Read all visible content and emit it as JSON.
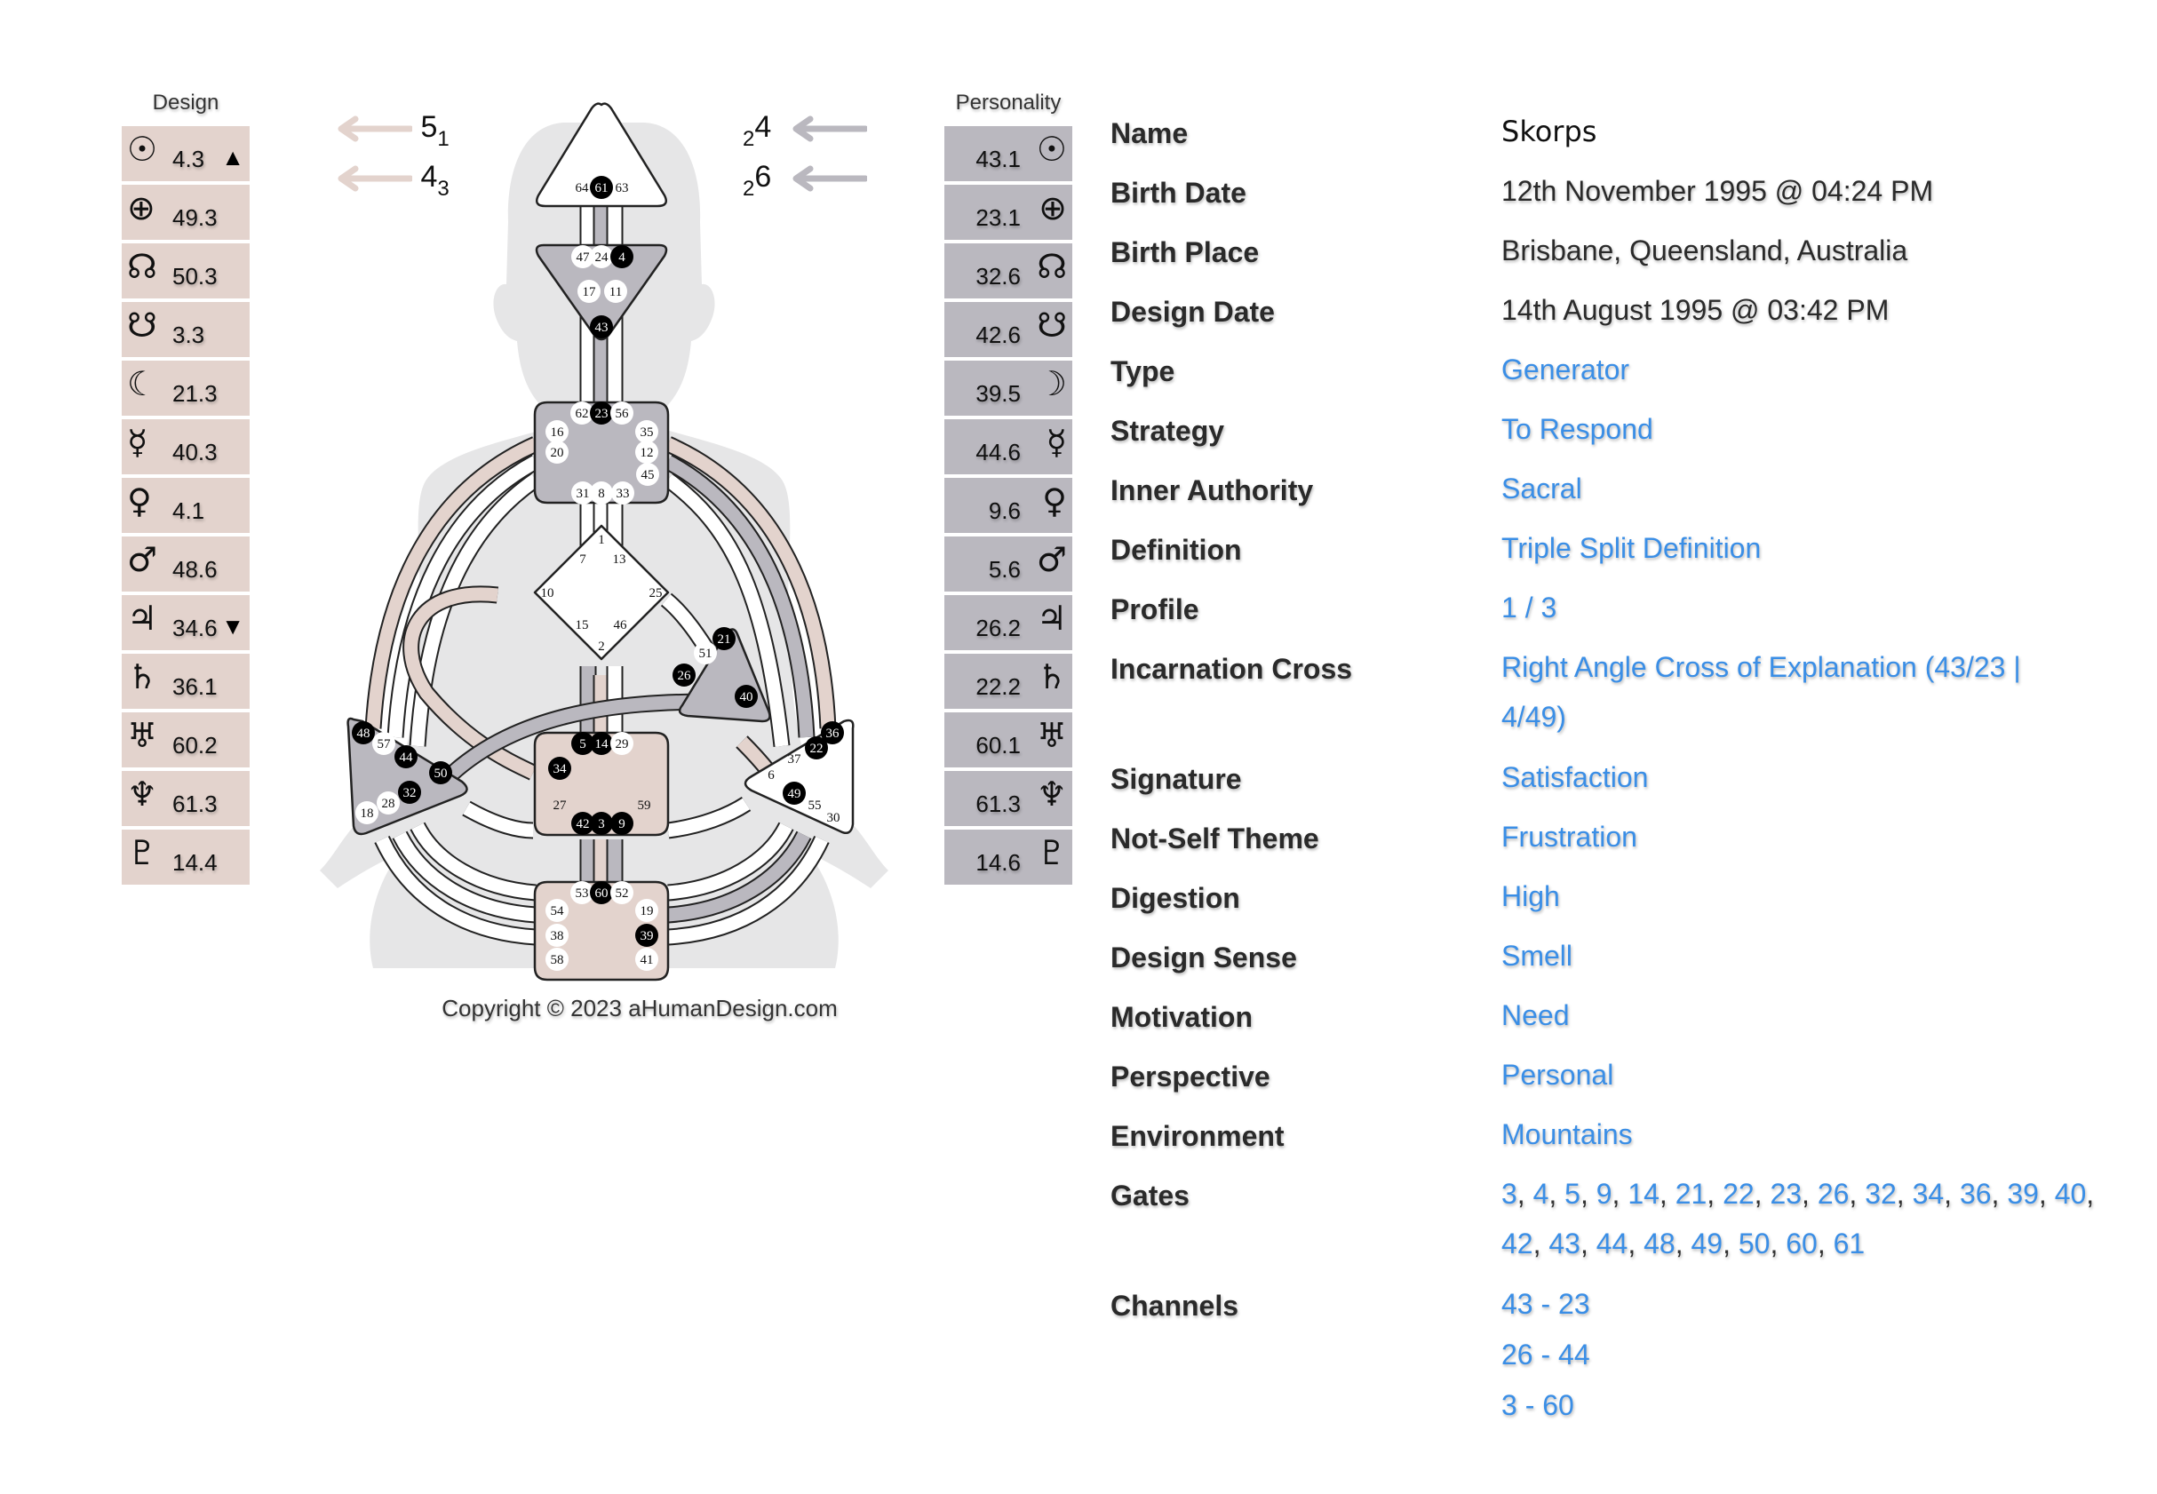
{
  "design": {
    "title": "Design",
    "color": "#e3d3cd",
    "planets": [
      {
        "planet": "Sun",
        "glyph": "☉",
        "icon": "sun-icon",
        "value": "4.3",
        "marker": "▲"
      },
      {
        "planet": "Earth",
        "glyph": "⊕",
        "icon": "earth-icon",
        "value": "49.3"
      },
      {
        "planet": "North Node",
        "glyph": "☊",
        "icon": "north-node-icon",
        "value": "50.3"
      },
      {
        "planet": "South Node",
        "glyph": "☋",
        "icon": "south-node-icon",
        "value": "3.3"
      },
      {
        "planet": "Moon",
        "glyph": "☾",
        "icon": "moon-icon",
        "value": "21.3"
      },
      {
        "planet": "Mercury",
        "glyph": "☿",
        "icon": "mercury-icon",
        "value": "40.3"
      },
      {
        "planet": "Venus",
        "glyph": "♀",
        "icon": "venus-icon",
        "value": "4.1"
      },
      {
        "planet": "Mars",
        "glyph": "♂",
        "icon": "mars-icon",
        "value": "48.6"
      },
      {
        "planet": "Jupiter",
        "glyph": "♃",
        "icon": "jupiter-icon",
        "value": "34.6",
        "marker": "▼"
      },
      {
        "planet": "Saturn",
        "glyph": "♄",
        "icon": "saturn-icon",
        "value": "36.1"
      },
      {
        "planet": "Uranus",
        "glyph": "♅",
        "icon": "uranus-icon",
        "value": "60.2"
      },
      {
        "planet": "Neptune",
        "glyph": "♆",
        "icon": "neptune-icon",
        "value": "61.3"
      },
      {
        "planet": "Pluto",
        "glyph": "♇",
        "icon": "pluto-icon",
        "value": "14.4"
      }
    ]
  },
  "personality": {
    "title": "Personality",
    "color": "#bab8bf",
    "planets": [
      {
        "planet": "Sun",
        "glyph": "☉",
        "icon": "sun-icon",
        "value": "43.1"
      },
      {
        "planet": "Earth",
        "glyph": "⊕",
        "icon": "earth-icon",
        "value": "23.1"
      },
      {
        "planet": "North Node",
        "glyph": "☊",
        "icon": "north-node-icon",
        "value": "32.6"
      },
      {
        "planet": "South Node",
        "glyph": "☋",
        "icon": "south-node-icon",
        "value": "42.6"
      },
      {
        "planet": "Moon",
        "glyph": "☽",
        "icon": "moon-icon",
        "value": "39.5"
      },
      {
        "planet": "Mercury",
        "glyph": "☿",
        "icon": "mercury-icon",
        "value": "44.6"
      },
      {
        "planet": "Venus",
        "glyph": "♀",
        "icon": "venus-icon",
        "value": "9.6"
      },
      {
        "planet": "Mars",
        "glyph": "♂",
        "icon": "mars-icon",
        "value": "5.6"
      },
      {
        "planet": "Jupiter",
        "glyph": "♃",
        "icon": "jupiter-icon",
        "value": "26.2"
      },
      {
        "planet": "Saturn",
        "glyph": "♄",
        "icon": "saturn-icon",
        "value": "22.2"
      },
      {
        "planet": "Uranus",
        "glyph": "♅",
        "icon": "uranus-icon",
        "value": "60.1"
      },
      {
        "planet": "Neptune",
        "glyph": "♆",
        "icon": "neptune-icon",
        "value": "61.3"
      },
      {
        "planet": "Pluto",
        "glyph": "♇",
        "icon": "pluto-icon",
        "value": "14.6"
      }
    ]
  },
  "variables": {
    "design_top": {
      "main": "5",
      "sub": "1"
    },
    "design_bottom": {
      "main": "4",
      "sub": "3"
    },
    "personality_top": {
      "main": "4",
      "sub": "2"
    },
    "personality_bottom": {
      "main": "6",
      "sub": "2"
    }
  },
  "bodygraph": {
    "colors": {
      "design": "#e3d3cd",
      "personality": "#bab8bf",
      "defined_gate": "#000000",
      "open": "#ffffff",
      "silhouette": "#e6e6e7"
    },
    "centers": [
      {
        "name": "head",
        "defined": false,
        "gates": [
          {
            "n": "64",
            "on": false
          },
          {
            "n": "61",
            "on": true
          },
          {
            "n": "63",
            "on": false
          }
        ]
      },
      {
        "name": "ajna",
        "defined": true,
        "fill": "personality",
        "gates": [
          {
            "n": "47",
            "on": false
          },
          {
            "n": "24",
            "on": false
          },
          {
            "n": "4",
            "on": true
          },
          {
            "n": "17",
            "on": false
          },
          {
            "n": "11",
            "on": false
          },
          {
            "n": "43",
            "on": true
          }
        ]
      },
      {
        "name": "throat",
        "defined": true,
        "fill": "personality",
        "gates": [
          {
            "n": "62",
            "on": false
          },
          {
            "n": "23",
            "on": true
          },
          {
            "n": "56",
            "on": false
          },
          {
            "n": "16",
            "on": false
          },
          {
            "n": "35",
            "on": false
          },
          {
            "n": "20",
            "on": false
          },
          {
            "n": "12",
            "on": false
          },
          {
            "n": "45",
            "on": false
          },
          {
            "n": "31",
            "on": false
          },
          {
            "n": "8",
            "on": false
          },
          {
            "n": "33",
            "on": false
          }
        ]
      },
      {
        "name": "g-center",
        "defined": false,
        "gates": [
          {
            "n": "1",
            "on": false
          },
          {
            "n": "7",
            "on": false
          },
          {
            "n": "13",
            "on": false
          },
          {
            "n": "10",
            "on": false
          },
          {
            "n": "25",
            "on": false
          },
          {
            "n": "15",
            "on": false
          },
          {
            "n": "46",
            "on": false
          },
          {
            "n": "2",
            "on": false
          }
        ]
      },
      {
        "name": "heart",
        "defined": true,
        "fill": "personality",
        "gates": [
          {
            "n": "21",
            "on": true
          },
          {
            "n": "51",
            "on": false
          },
          {
            "n": "26",
            "on": true
          },
          {
            "n": "40",
            "on": true
          }
        ]
      },
      {
        "name": "spleen",
        "defined": true,
        "fill": "personality",
        "gates": [
          {
            "n": "48",
            "on": true
          },
          {
            "n": "57",
            "on": false
          },
          {
            "n": "44",
            "on": true
          },
          {
            "n": "50",
            "on": true
          },
          {
            "n": "32",
            "on": true
          },
          {
            "n": "28",
            "on": false
          },
          {
            "n": "18",
            "on": false
          }
        ]
      },
      {
        "name": "sacral",
        "defined": true,
        "fill": "design",
        "gates": [
          {
            "n": "5",
            "on": true
          },
          {
            "n": "14",
            "on": true
          },
          {
            "n": "29",
            "on": false
          },
          {
            "n": "34",
            "on": true
          },
          {
            "n": "27",
            "on": false
          },
          {
            "n": "59",
            "on": false
          },
          {
            "n": "42",
            "on": true
          },
          {
            "n": "3",
            "on": true
          },
          {
            "n": "9",
            "on": true
          }
        ]
      },
      {
        "name": "solar-plexus",
        "defined": false,
        "gates": [
          {
            "n": "36",
            "on": true
          },
          {
            "n": "22",
            "on": true
          },
          {
            "n": "37",
            "on": false
          },
          {
            "n": "6",
            "on": false
          },
          {
            "n": "49",
            "on": true
          },
          {
            "n": "55",
            "on": false
          },
          {
            "n": "30",
            "on": false
          }
        ]
      },
      {
        "name": "root",
        "defined": true,
        "fill": "design",
        "gates": [
          {
            "n": "53",
            "on": false
          },
          {
            "n": "60",
            "on": true
          },
          {
            "n": "52",
            "on": false
          },
          {
            "n": "54",
            "on": false
          },
          {
            "n": "19",
            "on": false
          },
          {
            "n": "38",
            "on": false
          },
          {
            "n": "39",
            "on": true
          },
          {
            "n": "58",
            "on": false
          },
          {
            "n": "41",
            "on": false
          }
        ]
      }
    ]
  },
  "copyright": "Copyright © 2023 aHumanDesign.com",
  "info": {
    "name": {
      "label": "Name",
      "value": "Skorps"
    },
    "birth_date": {
      "label": "Birth Date",
      "value": "12th November 1995 @ 04:24 PM"
    },
    "birth_place": {
      "label": "Birth Place",
      "value": "Brisbane, Queensland, Australia"
    },
    "design_date": {
      "label": "Design Date",
      "value": "14th August 1995 @ 03:42 PM"
    },
    "type": {
      "label": "Type",
      "value": "Generator"
    },
    "strategy": {
      "label": "Strategy",
      "value": "To Respond"
    },
    "inner_authority": {
      "label": "Inner Authority",
      "value": "Sacral"
    },
    "definition": {
      "label": "Definition",
      "value": "Triple Split Definition"
    },
    "profile": {
      "label": "Profile",
      "value": "1 / 3"
    },
    "incarnation_cross": {
      "label": "Incarnation Cross",
      "value": "Right Angle Cross of Explanation (43/23 | 4/49)"
    },
    "signature": {
      "label": "Signature",
      "value": "Satisfaction"
    },
    "not_self_theme": {
      "label": "Not-Self Theme",
      "value": "Frustration"
    },
    "digestion": {
      "label": "Digestion",
      "value": "High"
    },
    "design_sense": {
      "label": "Design Sense",
      "value": "Smell"
    },
    "motivation": {
      "label": "Motivation",
      "value": "Need"
    },
    "perspective": {
      "label": "Perspective",
      "value": "Personal"
    },
    "environment": {
      "label": "Environment",
      "value": "Mountains"
    },
    "gates": {
      "label": "Gates",
      "values": [
        "3",
        "4",
        "5",
        "9",
        "14",
        "21",
        "22",
        "23",
        "26",
        "32",
        "34",
        "36",
        "39",
        "40",
        "42",
        "43",
        "44",
        "48",
        "49",
        "50",
        "60",
        "61"
      ]
    },
    "channels": {
      "label": "Channels",
      "values": [
        "43 - 23",
        "26 - 44",
        "3 - 60"
      ]
    },
    "link_color": "#3a8ee6"
  }
}
